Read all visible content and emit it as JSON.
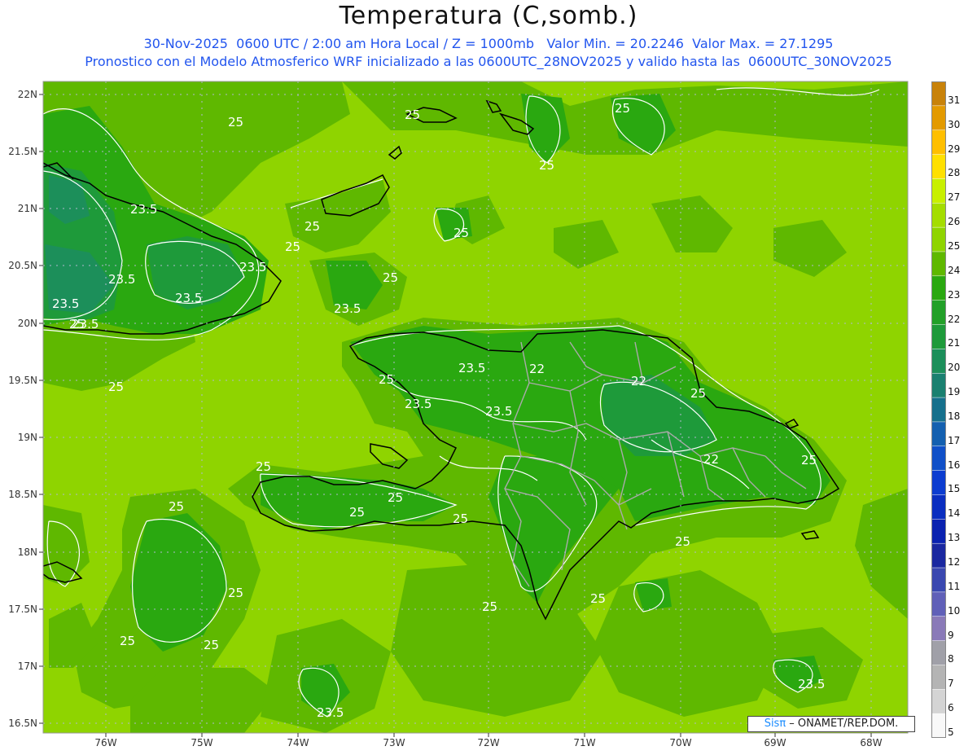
{
  "header": {
    "title": "Temperatura (C,somb.)",
    "subtitle1": "30-Nov-2025  0600 UTC / 2:00 am Hora Local / Z = 1000mb   Valor Min. = 20.2246  Valor Max. = 27.1295",
    "subtitle2": "Pronostico con el Modelo Atmosferico WRF inicializado a las 0600UTC_28NOV2025 y valido hasta las  0600UTC_30NOV2025"
  },
  "map": {
    "lat_labels": [
      "22N",
      "21.5N",
      "21N",
      "20.5N",
      "20N",
      "19.5N",
      "19N",
      "18.5N",
      "18N",
      "17.5N",
      "17N",
      "16.5N"
    ],
    "lon_labels": [
      "76W",
      "75W",
      "74W",
      "73W",
      "72W",
      "71W",
      "70W",
      "69W",
      "68W"
    ],
    "contour_labels": [
      "25",
      "25",
      "25",
      "25",
      "25",
      "25",
      "25",
      "25",
      "25",
      "25",
      "25",
      "25",
      "25",
      "25",
      "25",
      "25",
      "25",
      "25",
      "25",
      "25",
      "25",
      "25",
      "25",
      "25",
      "23.5",
      "23.5",
      "23.5",
      "23.5",
      "23.5",
      "23.5",
      "23.5",
      "23.5",
      "23.5",
      "23.5",
      "23.5",
      "23.5",
      "22",
      "22",
      "22"
    ],
    "colors": {
      "t25": "#8fd400",
      "t24": "#5fb800",
      "t23": "#2aa810",
      "t22": "#1e9a3a",
      "t21": "#1c8f5a"
    }
  },
  "colorbar": {
    "labels": [
      "31",
      "30",
      "29",
      "28",
      "27",
      "26",
      "25",
      "24",
      "23",
      "22",
      "21",
      "20",
      "19",
      "18",
      "17",
      "16",
      "15",
      "14",
      "13",
      "12",
      "11",
      "10",
      "9",
      "8",
      "7",
      "6",
      "5"
    ],
    "colors": [
      "#c8820a",
      "#e39a00",
      "#ffbf00",
      "#ffe000",
      "#c8f000",
      "#a4dd00",
      "#8fd400",
      "#5fb800",
      "#2aa810",
      "#22a028",
      "#1e9a3a",
      "#1c8f5a",
      "#1a8070",
      "#16708c",
      "#1460b0",
      "#1050c8",
      "#0c3cd0",
      "#0a2ec0",
      "#0a22b0",
      "#1a28a0",
      "#3a48b0",
      "#6060b8",
      "#8a7ab8",
      "#a0a0a8",
      "#b4b4b4",
      "#d4d4d4",
      "#f8f8f8"
    ]
  },
  "credit": {
    "sis": "Sis",
    "pi": "π",
    "org": " – ONAMET/REP.DOM."
  }
}
